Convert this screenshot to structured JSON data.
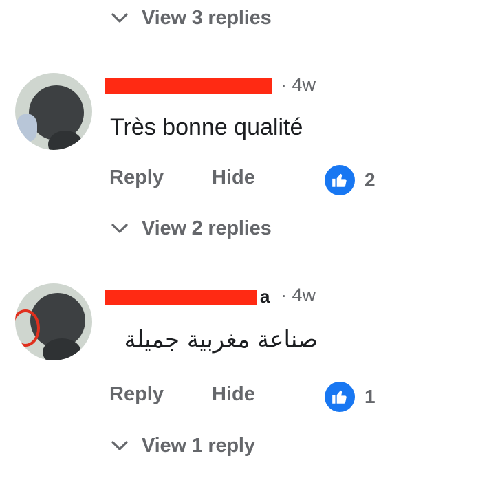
{
  "thread": {
    "top_view_replies": "View 3 replies",
    "comments": [
      {
        "time": "· 4w",
        "text": "Très bonne qualité",
        "reply_label": "Reply",
        "hide_label": "Hide",
        "like_count": "2",
        "view_replies": "View 2 replies"
      },
      {
        "name_tail": "a",
        "time": "· 4w",
        "text": "صناعة مغربية جميلة",
        "reply_label": "Reply",
        "hide_label": "Hide",
        "like_count": "1",
        "view_replies": "View 1 reply"
      }
    ]
  },
  "colors": {
    "redaction": "#ff2a13",
    "like_blue": "#1877f2",
    "secondary_text": "#65676b"
  },
  "icons": [
    "chevron-down-icon",
    "thumbs-up-icon"
  ]
}
